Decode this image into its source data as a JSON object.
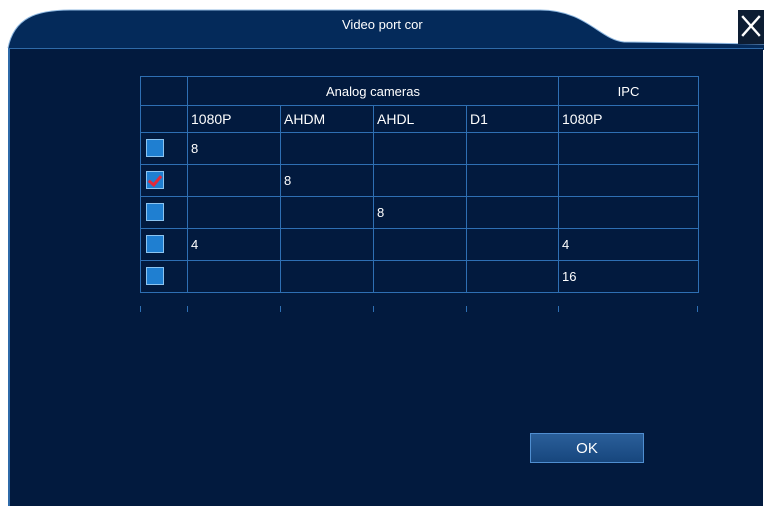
{
  "window": {
    "title": "Video port cor"
  },
  "table": {
    "group_headers": {
      "analog": "Analog cameras",
      "ipc": "IPC"
    },
    "column_headers": [
      "1080P",
      "AHDM",
      "AHDL",
      "D1",
      "1080P"
    ],
    "rows": [
      {
        "checked": false,
        "values": [
          "8",
          "",
          "",
          "",
          ""
        ]
      },
      {
        "checked": true,
        "values": [
          "",
          "8",
          "",
          "",
          ""
        ]
      },
      {
        "checked": false,
        "values": [
          "",
          "",
          "8",
          "",
          ""
        ]
      },
      {
        "checked": false,
        "values": [
          "4",
          "",
          "",
          "",
          "4"
        ]
      },
      {
        "checked": false,
        "values": [
          "",
          "",
          "",
          "",
          "16"
        ]
      }
    ]
  },
  "buttons": {
    "ok_label": "OK",
    "close_icon": "close-icon"
  },
  "colors": {
    "panel_bg": "#021a3e",
    "grid_line": "#2e6fb3",
    "checkbox": "#1f7fd1",
    "checkmark": "#e32a3a"
  }
}
